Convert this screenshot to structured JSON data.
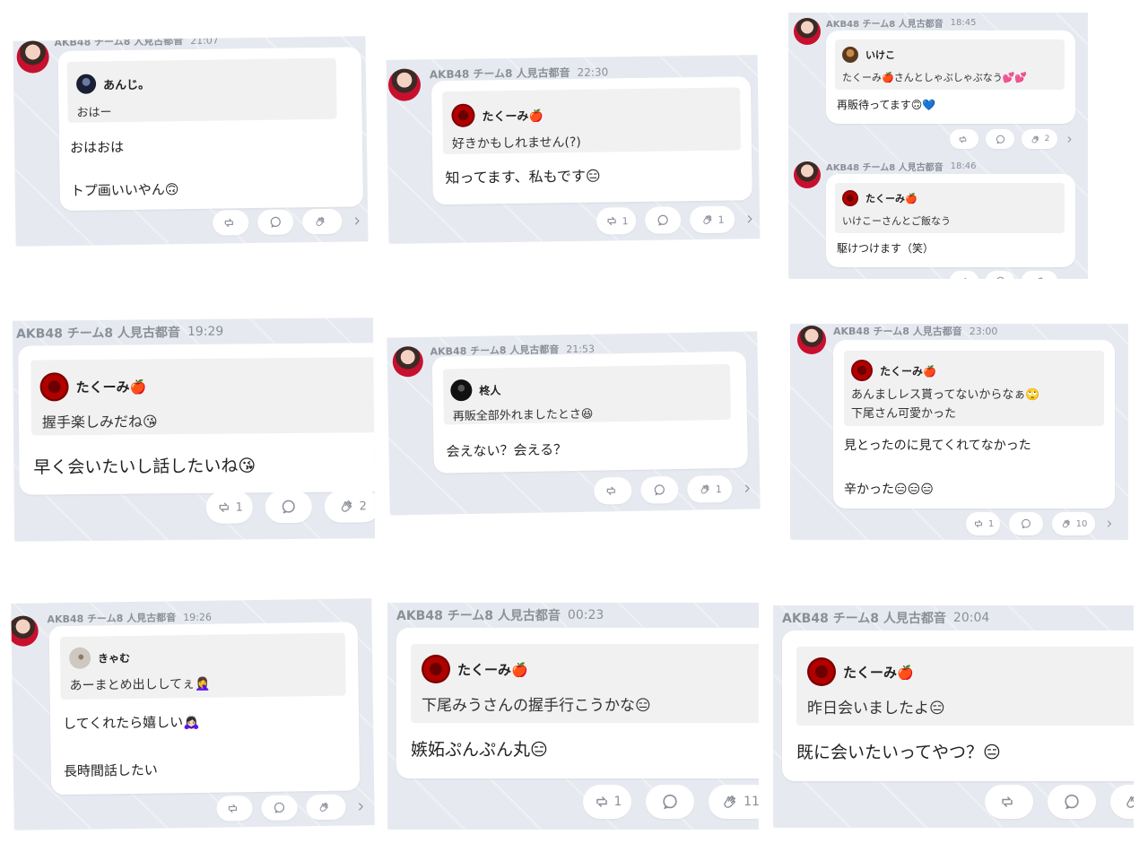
{
  "tiles": [
    {
      "header": "AKB48 チーム8 人見古都音",
      "time": "21:07",
      "quote_user": "あんじ。",
      "quote_text": "おはー",
      "text": "おはおは\n\nトプ画いいやん🙃",
      "retweet_count": "",
      "clap_count": ""
    },
    {
      "header": "AKB48 チーム8 人見古都音",
      "time": "22:30",
      "quote_user": "たくーみ🍎",
      "quote_text": "好きかもしれません(?)",
      "text": "知ってます、私もです😑",
      "retweet_count": "1",
      "clap_count": "1"
    },
    {
      "header": "AKB48 チーム8 人見古都音",
      "time": "18:45",
      "quote_user": "いけこ",
      "quote_text": "たくーみ🍎さんとしゃぶしゃぶなう💕💕",
      "text": "再販待ってます🙃💙",
      "retweet_count": "",
      "clap_count": "2",
      "second": {
        "header": "AKB48 チーム8 人見古都音",
        "time": "18:46",
        "quote_user": "たくーみ🍎",
        "quote_text": "いけこーさんとご飯なう",
        "text": "駆けつけます（笑）"
      }
    },
    {
      "header": "AKB48 チーム8 人見古都音",
      "time": "19:29",
      "quote_user": "たくーみ🍎",
      "quote_text": "握手楽しみだね😘",
      "text": "早く会いたいし話したいね😘",
      "retweet_count": "1",
      "clap_count": "2"
    },
    {
      "header": "AKB48 チーム8 人見古都音",
      "time": "21:53",
      "quote_user": "柊人",
      "quote_text": "再販全部外れましたとさ😆",
      "text": "会えない？会える？",
      "retweet_count": "",
      "clap_count": "1"
    },
    {
      "header": "AKB48 チーム8 人見古都音",
      "time": "23:00",
      "quote_user": "たくーみ🍎",
      "quote_text": "あんましレス貰ってないからなぁ🙄\n下尾さん可愛かった",
      "text": "見とったのに見てくれてなかった\n\n辛かった😑😑😑",
      "retweet_count": "1",
      "clap_count": "10"
    },
    {
      "header": "AKB48 チーム8 人見古都音",
      "time": "19:26",
      "quote_user": "きゃむ",
      "quote_text": "あーまとめ出ししてぇ🤦‍♀️",
      "text": "してくれたら嬉しい🙇🏻‍♀️\n\n長時間話したい",
      "retweet_count": "",
      "clap_count": ""
    },
    {
      "header": "AKB48 チーム8 人見古都音",
      "time": "00:23",
      "quote_user": "たくーみ🍎",
      "quote_text": "下尾みうさんの握手行こうかな😑",
      "text": "嫉妬ぷんぷん丸😑",
      "retweet_count": "1",
      "clap_count": "11"
    },
    {
      "header": "AKB48 チーム8 人見古都音",
      "time": "20:04",
      "quote_user": "たくーみ🍎",
      "quote_text": "昨日会いましたよ😑",
      "text": "既に会いたいってやつ？😑",
      "retweet_count": "",
      "clap_count": ""
    }
  ]
}
